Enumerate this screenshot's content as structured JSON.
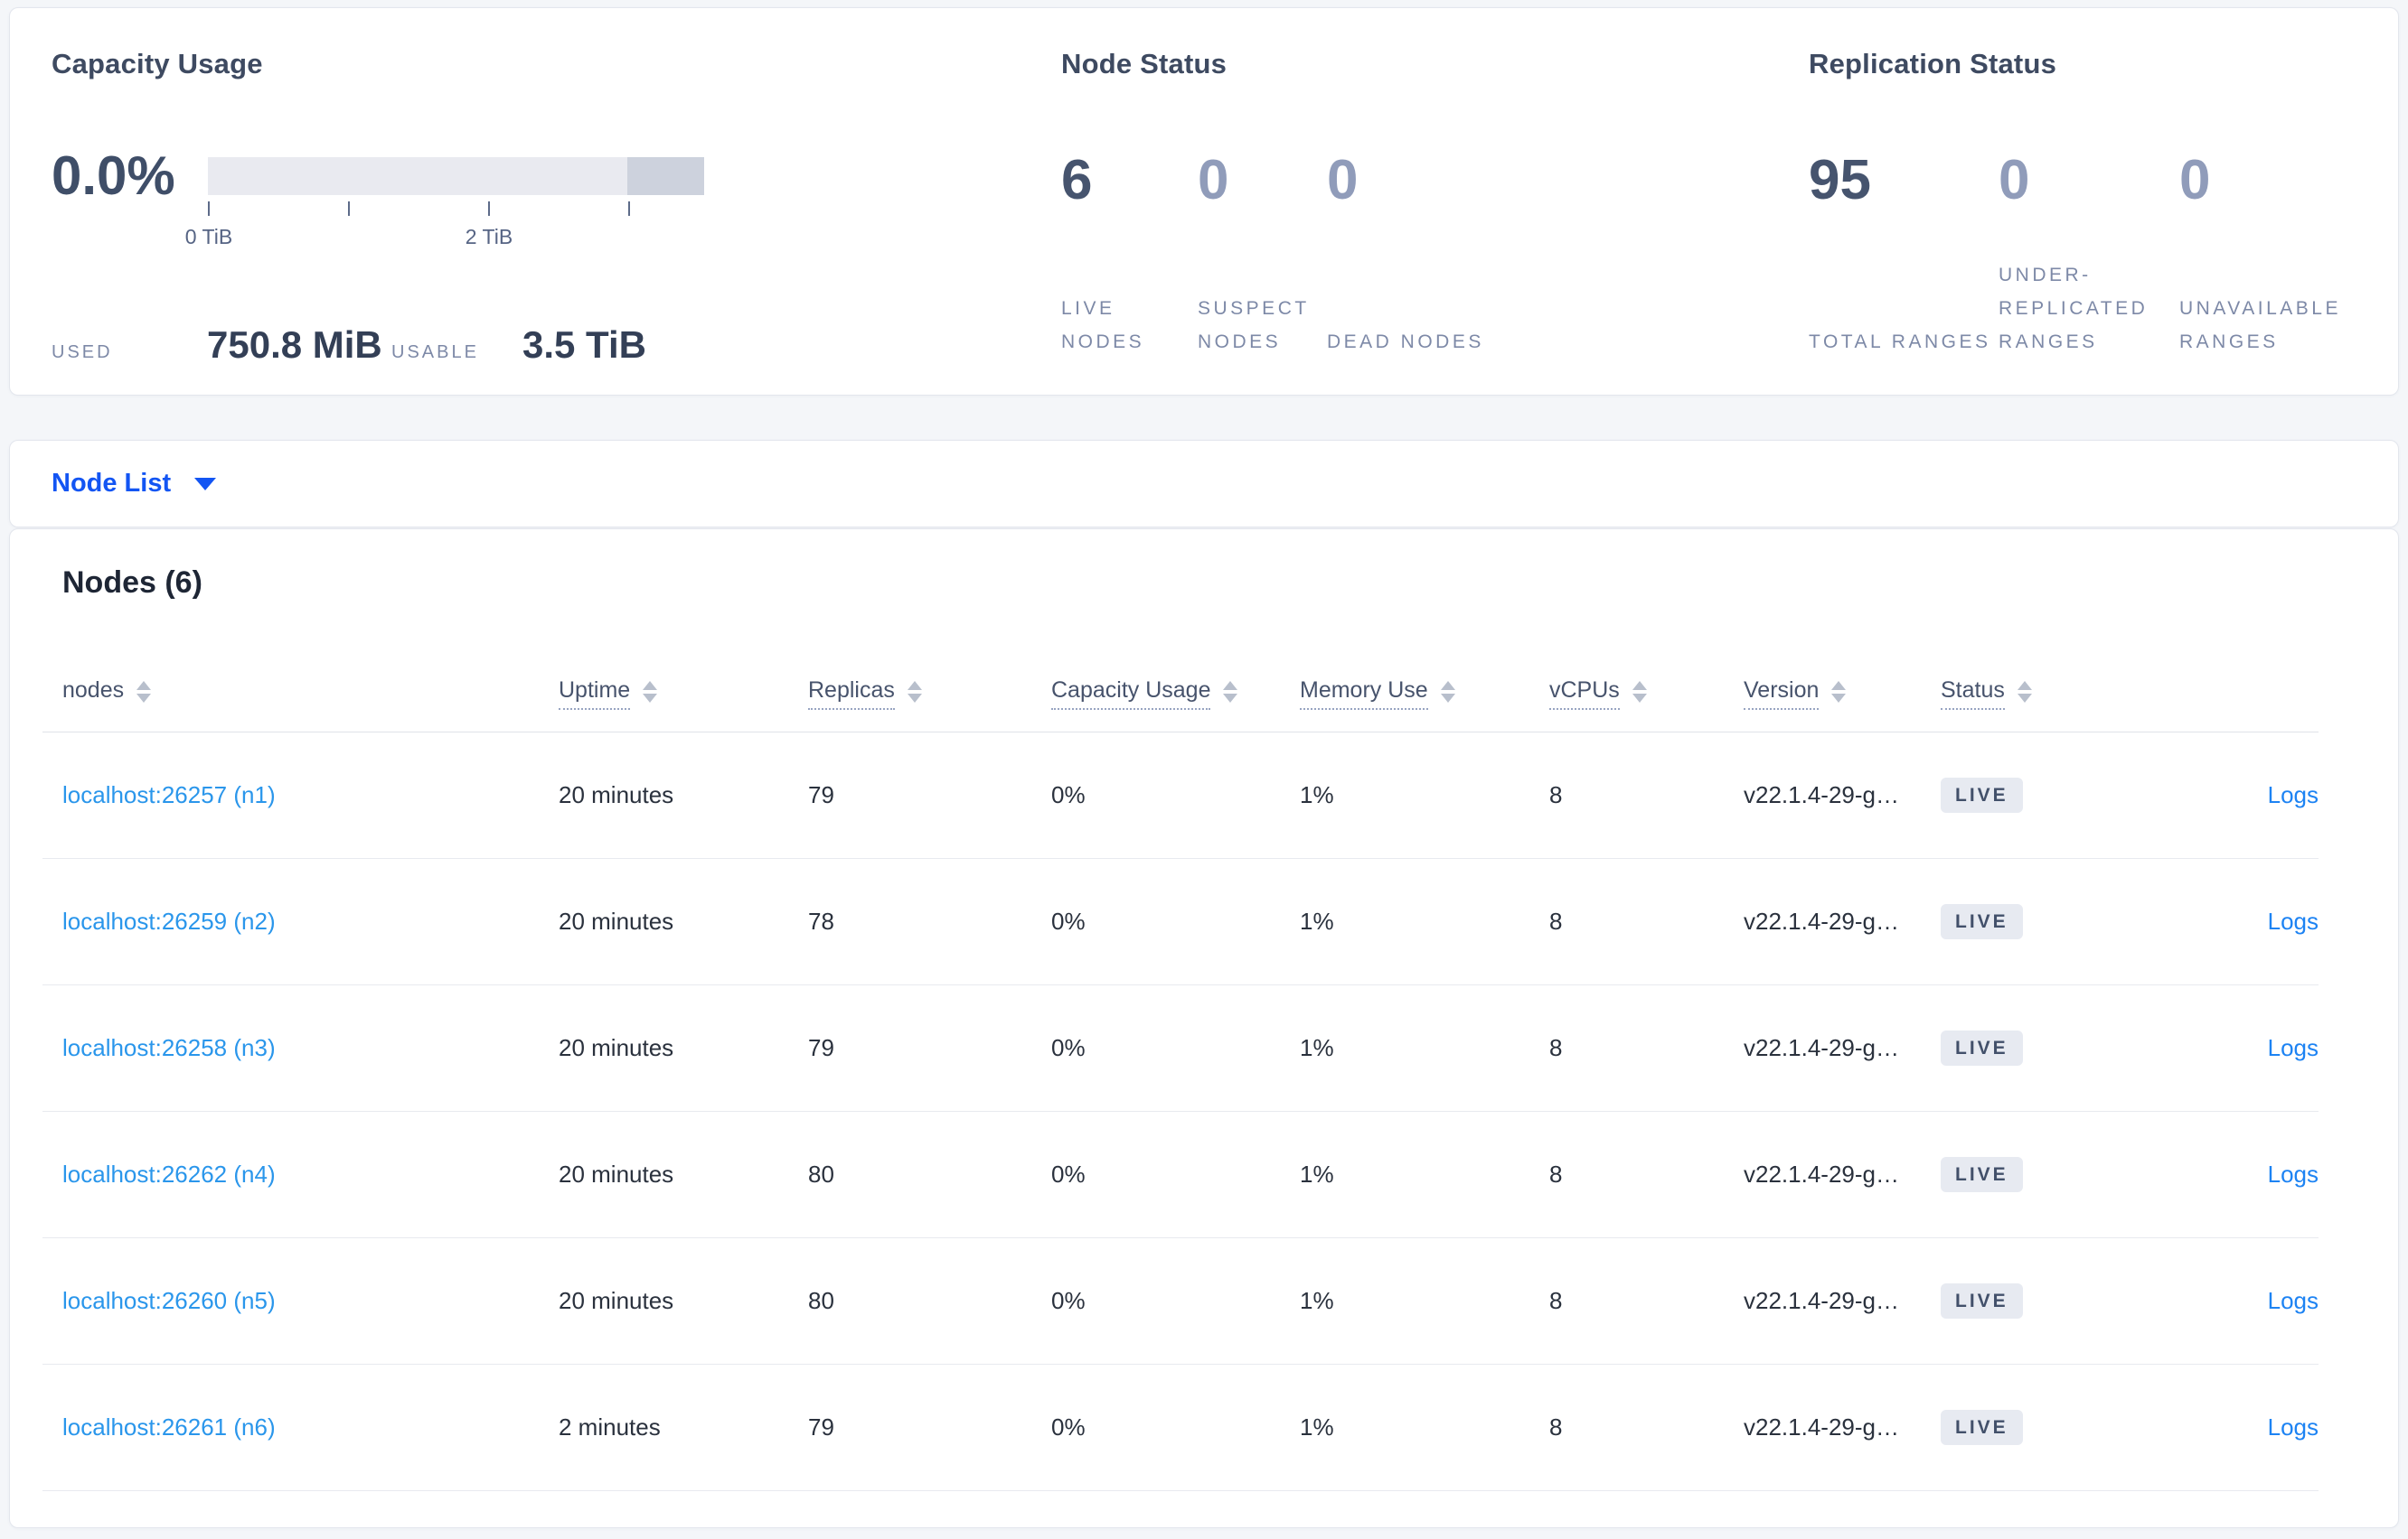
{
  "summary": {
    "capacity": {
      "title": "Capacity Usage",
      "percent": "0.0%",
      "bar": {
        "track_color": "#e9eaf0",
        "segment_color": "#cdd2dd",
        "segment_width_pct": 15.5
      },
      "tick_labels": [
        "0 TiB",
        "",
        "2 TiB",
        ""
      ],
      "used_label": "USED",
      "used_value": "750.8 MiB",
      "usable_label": "USABLE",
      "usable_value": "3.5 TiB"
    },
    "node_status": {
      "title": "Node Status",
      "stats": [
        {
          "value": "6",
          "label": "LIVE NODES",
          "primary": true
        },
        {
          "value": "0",
          "label": "SUSPECT NODES",
          "primary": false
        },
        {
          "value": "0",
          "label": "DEAD NODES",
          "primary": false
        }
      ]
    },
    "replication": {
      "title": "Replication Status",
      "stats": [
        {
          "value": "95",
          "label": "TOTAL RANGES",
          "primary": true
        },
        {
          "value": "0",
          "label": "UNDER-REPLICATED RANGES",
          "primary": false
        },
        {
          "value": "0",
          "label": "UNAVAILABLE RANGES",
          "primary": false
        }
      ]
    }
  },
  "view_selector": {
    "label": "Node List"
  },
  "nodes_section": {
    "heading": "Nodes (6)",
    "columns": [
      {
        "key": "node",
        "label": "nodes",
        "underlined": false
      },
      {
        "key": "uptime",
        "label": "Uptime",
        "underlined": true
      },
      {
        "key": "replicas",
        "label": "Replicas",
        "underlined": true
      },
      {
        "key": "capacity",
        "label": "Capacity Usage",
        "underlined": true
      },
      {
        "key": "memory",
        "label": "Memory Use",
        "underlined": true
      },
      {
        "key": "vcpus",
        "label": "vCPUs",
        "underlined": true
      },
      {
        "key": "version",
        "label": "Version",
        "underlined": true
      },
      {
        "key": "status",
        "label": "Status",
        "underlined": true
      }
    ],
    "rows": [
      {
        "node": "localhost:26257 (n1)",
        "uptime": "20 minutes",
        "replicas": "79",
        "capacity": "0%",
        "memory": "1%",
        "vcpus": "8",
        "version": "v22.1.4-29-g…",
        "status": "LIVE",
        "logs": "Logs"
      },
      {
        "node": "localhost:26259 (n2)",
        "uptime": "20 minutes",
        "replicas": "78",
        "capacity": "0%",
        "memory": "1%",
        "vcpus": "8",
        "version": "v22.1.4-29-g…",
        "status": "LIVE",
        "logs": "Logs"
      },
      {
        "node": "localhost:26258 (n3)",
        "uptime": "20 minutes",
        "replicas": "79",
        "capacity": "0%",
        "memory": "1%",
        "vcpus": "8",
        "version": "v22.1.4-29-g…",
        "status": "LIVE",
        "logs": "Logs"
      },
      {
        "node": "localhost:26262 (n4)",
        "uptime": "20 minutes",
        "replicas": "80",
        "capacity": "0%",
        "memory": "1%",
        "vcpus": "8",
        "version": "v22.1.4-29-g…",
        "status": "LIVE",
        "logs": "Logs"
      },
      {
        "node": "localhost:26260 (n5)",
        "uptime": "20 minutes",
        "replicas": "80",
        "capacity": "0%",
        "memory": "1%",
        "vcpus": "8",
        "version": "v22.1.4-29-g…",
        "status": "LIVE",
        "logs": "Logs"
      },
      {
        "node": "localhost:26261 (n6)",
        "uptime": "2 minutes",
        "replicas": "79",
        "capacity": "0%",
        "memory": "1%",
        "vcpus": "8",
        "version": "v22.1.4-29-g…",
        "status": "LIVE",
        "logs": "Logs"
      }
    ]
  },
  "colors": {
    "page_background": "#f4f6f9",
    "primary_number": "#46546e",
    "muted_number": "#909cba",
    "selector_blue": "#1355f3",
    "node_link_blue": "#2a96eb",
    "logs_link_blue": "#1d83f3",
    "badge_background": "#e7eaf1",
    "badge_text": "#42506a"
  }
}
